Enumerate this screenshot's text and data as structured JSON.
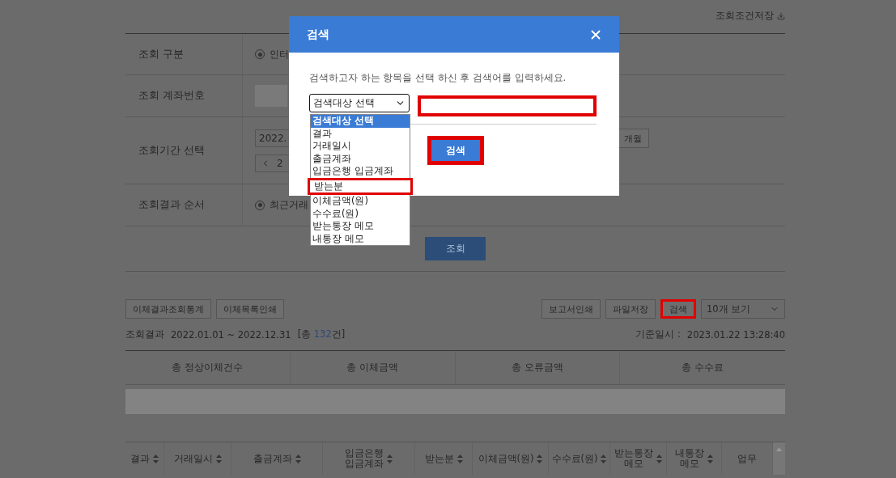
{
  "header": {
    "save_conditions": "조회조건저장"
  },
  "form": {
    "rows": [
      {
        "kind": "radio",
        "label": "조회 구분",
        "option": "인터",
        "checked": true
      },
      {
        "kind": "account",
        "label": "조회 계좌번호"
      },
      {
        "kind": "period",
        "label": "조회기간 선택",
        "start": "2022.",
        "nav_text": "2",
        "period_button": "개월"
      },
      {
        "kind": "radio",
        "label": "조회결과 순서",
        "option": "최근거래",
        "checked": true
      }
    ],
    "submit": "조회"
  },
  "toolbar": {
    "left": [
      "이체결과조회통계",
      "이체목록인쇄"
    ],
    "right": [
      {
        "label": "보고서인쇄",
        "highlighted": false
      },
      {
        "label": "파일저장",
        "highlighted": false
      },
      {
        "label": "검색",
        "highlighted": true
      }
    ],
    "page_size": "10개 보기"
  },
  "result_info": {
    "label": "조회결과",
    "range": "2022.01.01 ~ 2022.12.31",
    "count_prefix": "[총",
    "count": "132",
    "count_suffix": "건]",
    "base_label": "기준일시 :",
    "base_time": "2023.01.22 13:28:40"
  },
  "summary": {
    "columns": [
      "총 정상이체건수",
      "총 이체금액",
      "총 오류금액",
      "총 수수료"
    ]
  },
  "table": {
    "columns": [
      {
        "lines": [
          "결과"
        ],
        "sortable": true
      },
      {
        "lines": [
          "거래일시"
        ],
        "sortable": true
      },
      {
        "lines": [
          "출금계좌"
        ],
        "sortable": true
      },
      {
        "lines": [
          "입금은행",
          "입금계좌"
        ],
        "sortable": true
      },
      {
        "lines": [
          "받는분"
        ],
        "sortable": true
      },
      {
        "lines": [
          "이체금액(원)"
        ],
        "sortable": true
      },
      {
        "lines": [
          "수수료(원)"
        ],
        "sortable": true
      },
      {
        "lines": [
          "받는통장",
          "메모"
        ],
        "sortable": true
      },
      {
        "lines": [
          "내통장",
          "메모"
        ],
        "sortable": true
      },
      {
        "lines": [
          "업무"
        ],
        "sortable": false
      }
    ]
  },
  "modal": {
    "title": "검색",
    "description": "검색하고자 하는 항목을 선택 하신 후 검색어를 입력하세요.",
    "select": {
      "value": "검색대상 선택",
      "options": [
        {
          "label": "검색대상 선택",
          "selected": true,
          "highlighted": false
        },
        {
          "label": "결과",
          "selected": false,
          "highlighted": false
        },
        {
          "label": "거래일시",
          "selected": false,
          "highlighted": false
        },
        {
          "label": "출금계좌",
          "selected": false,
          "highlighted": false
        },
        {
          "label": "입금은행 입금계좌",
          "selected": false,
          "highlighted": false
        },
        {
          "label": "받는분",
          "selected": false,
          "highlighted": true
        },
        {
          "label": "이체금액(원)",
          "selected": false,
          "highlighted": false
        },
        {
          "label": "수수료(원)",
          "selected": false,
          "highlighted": false
        },
        {
          "label": "받는통장 메모",
          "selected": false,
          "highlighted": false
        },
        {
          "label": "내통장 메모",
          "selected": false,
          "highlighted": false
        }
      ]
    },
    "query": {
      "highlighted": true
    },
    "button": {
      "label": "검색",
      "highlighted": true
    }
  }
}
